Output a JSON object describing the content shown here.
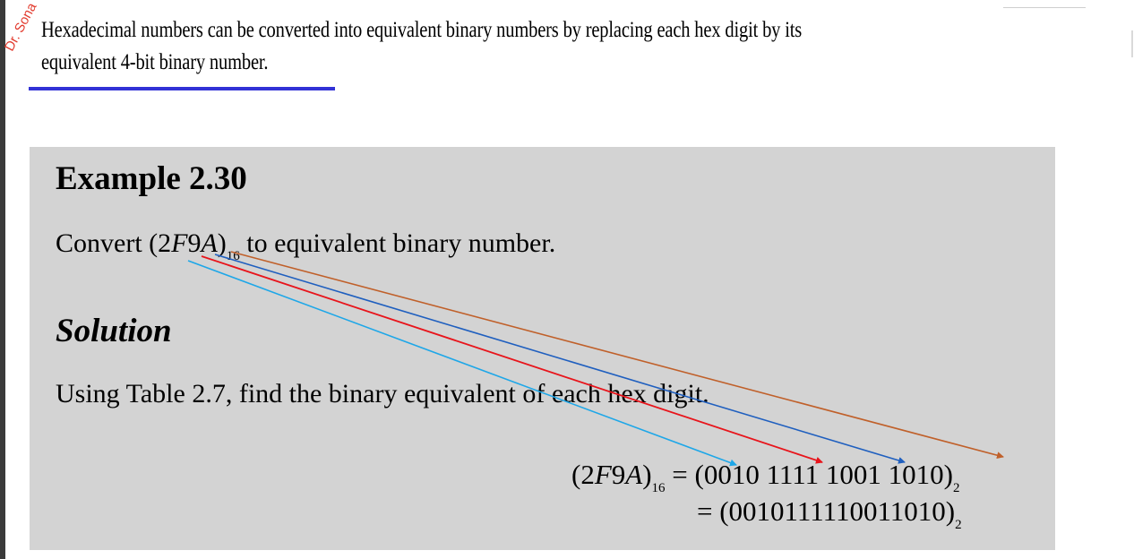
{
  "watermark": "Dr. Sona",
  "intro": {
    "line1": "Hexadecimal numbers can be converted into equivalent binary numbers by replacing each hex digit by its",
    "line2": "equivalent 4-bit binary number."
  },
  "example": {
    "title": "Example 2.30",
    "question_prefix": "Convert (2",
    "question_italic1": "F",
    "question_mid": "9",
    "question_italic2": "A",
    "question_close": ")",
    "question_sub": "16",
    "question_suffix": " to equivalent binary number."
  },
  "solution": {
    "title": "Solution",
    "text": "Using Table 2.7, find the binary equivalent of each hex digit.",
    "eq1_lhs_prefix": "(2",
    "eq1_lhs_italic": "F",
    "eq1_lhs_mid": "9",
    "eq1_lhs_italic2": "A",
    "eq1_lhs_close": ")",
    "eq1_lhs_sub": "16",
    "eq1_rhs": " = (0010 1111 1001 1010)",
    "eq1_rhs_sub": "2",
    "eq2": "= (0010111110011010)",
    "eq2_sub": "2"
  },
  "annotation_colors": {
    "arrow1": "#1ea7e8",
    "arrow2": "#e8141b",
    "arrow3": "#1f5fbf",
    "arrow4": "#c0602a",
    "underline": "#3232d6"
  }
}
